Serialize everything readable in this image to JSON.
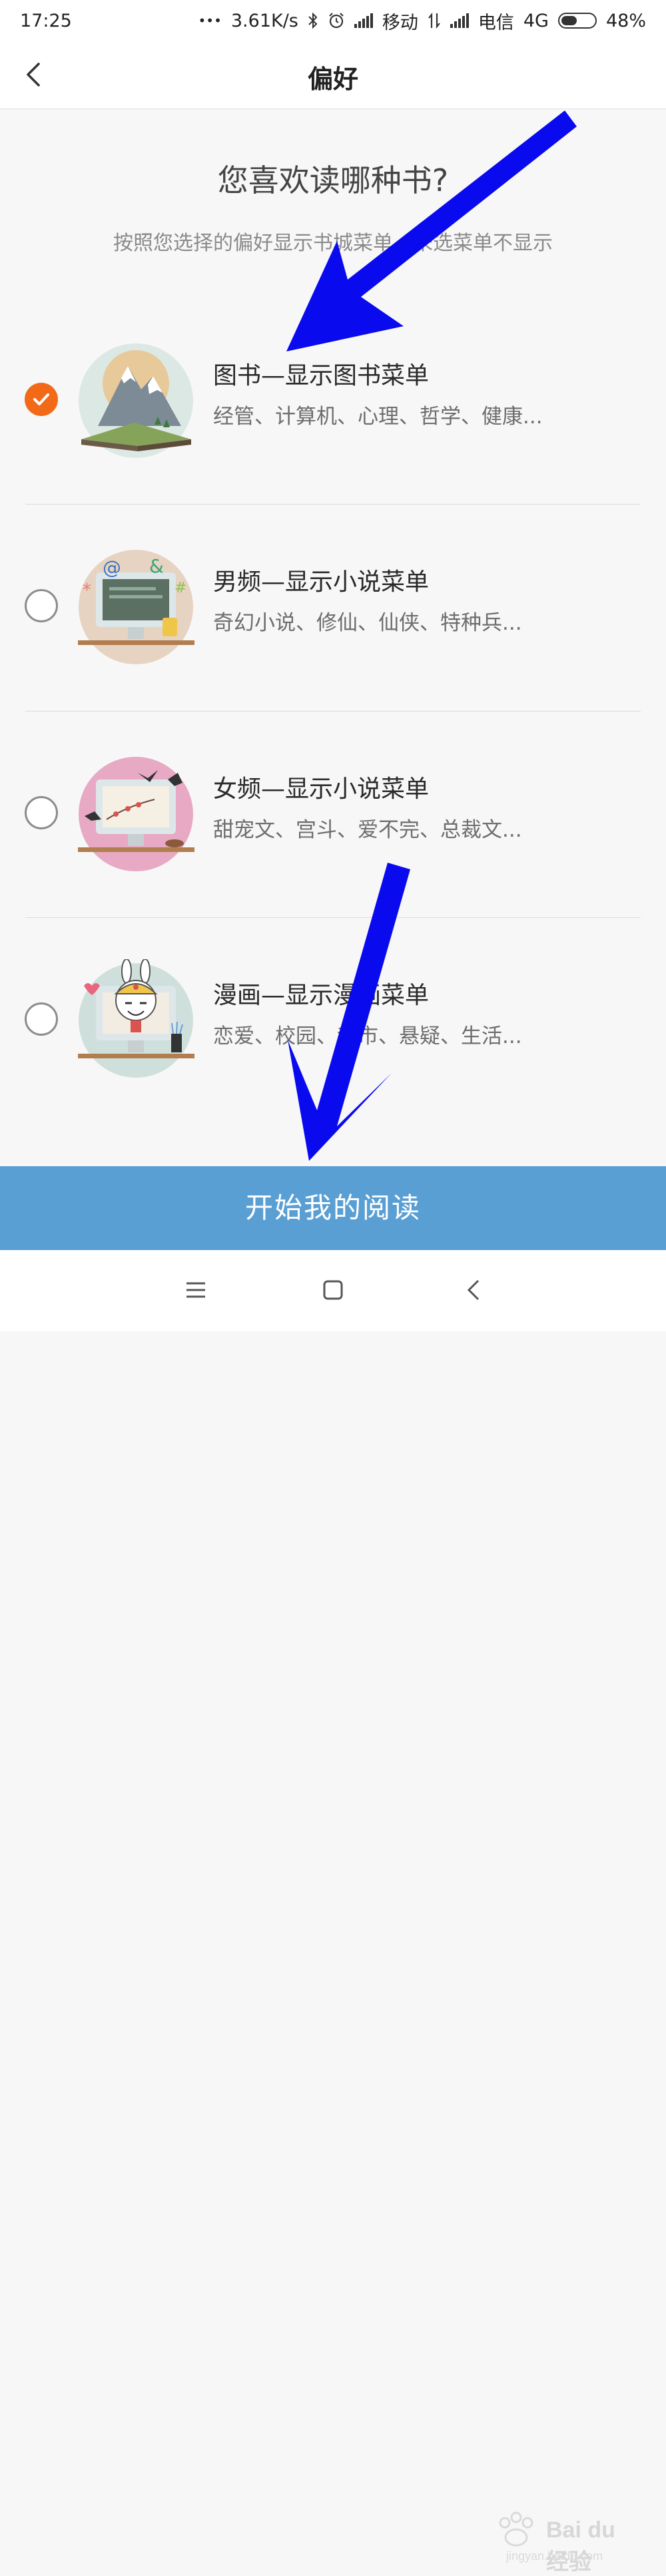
{
  "status_bar": {
    "time": "17:25",
    "dots": "•••",
    "net_speed": "3.61K/s",
    "carrier1": "移动",
    "carrier2": "电信",
    "network": "4G",
    "battery": "48%",
    "battery_level": 0.48,
    "icons": [
      "bluetooth-icon",
      "alarm-icon",
      "signal-icon",
      "data-icon",
      "battery-icon"
    ]
  },
  "header": {
    "title": "偏好"
  },
  "heading": "您喜欢读哪种书?",
  "subheading": "按照您选择的偏好显示书城菜单，未选菜单不显示",
  "options": [
    {
      "title": "图书—显示图书菜单",
      "desc": "经管、计算机、心理、哲学、健康...",
      "checked": true,
      "icon": "books-mountain-icon"
    },
    {
      "title": "男频—显示小说菜单",
      "desc": "奇幻小说、修仙、仙侠、特种兵...",
      "checked": false,
      "icon": "computer-symbols-icon"
    },
    {
      "title": "女频—显示小说菜单",
      "desc": "甜宠文、宫斗、爱不完、总裁文...",
      "checked": false,
      "icon": "computer-swallows-icon"
    },
    {
      "title": "漫画—显示漫画菜单",
      "desc": "恋爱、校园、都市、悬疑、生活...",
      "checked": false,
      "icon": "computer-rabbit-icon"
    }
  ],
  "start_button": "开始我的阅读",
  "watermark": {
    "brand": "Bai du 经验",
    "url": "jingyan.baidu.com"
  },
  "colors": {
    "accent": "#f26a17",
    "button": "#5a9fd4",
    "annotation_arrow": "#0a0aef"
  }
}
